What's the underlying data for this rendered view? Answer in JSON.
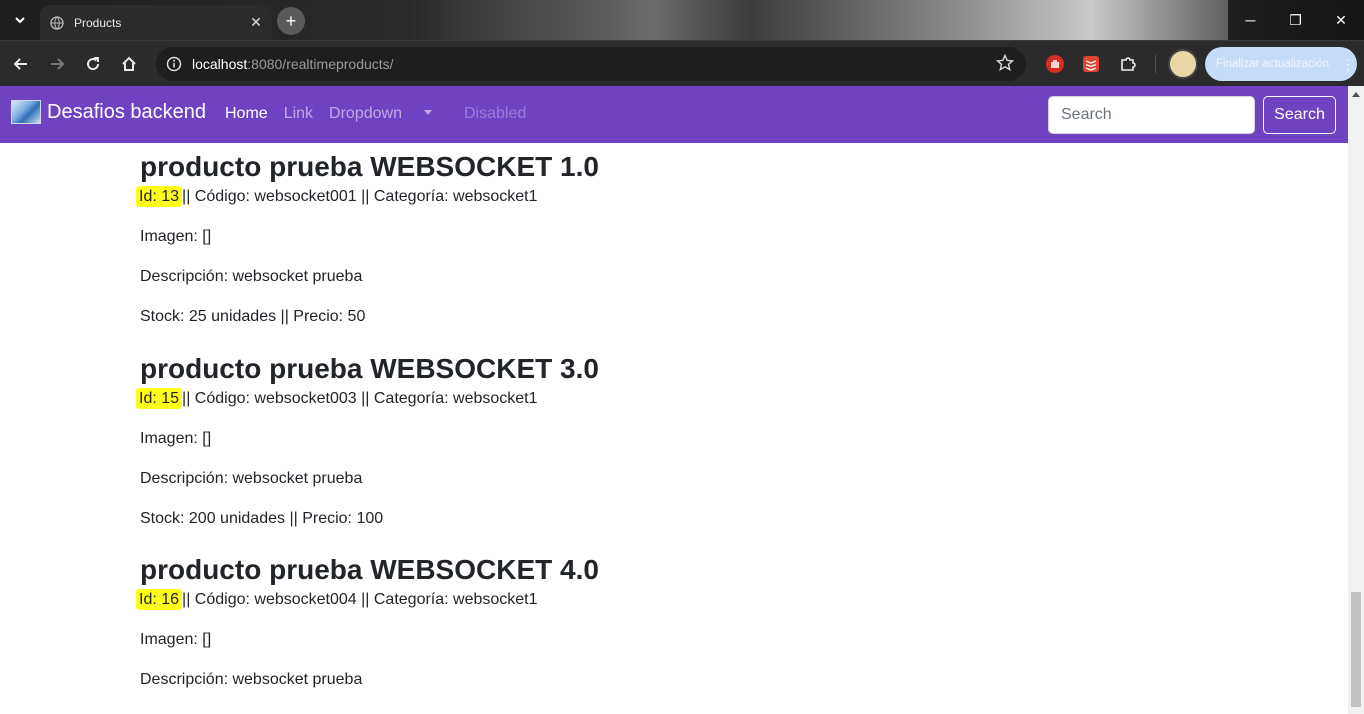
{
  "browser": {
    "tab_title": "Products",
    "url_host": "localhost",
    "url_rest": ":8080/realtimeproducts/",
    "update_label": "Finalizar actualización"
  },
  "navbar": {
    "brand": "Desafios backend",
    "links": [
      "Home",
      "Link",
      "Dropdown",
      "Disabled"
    ],
    "search_placeholder": "Search",
    "search_button": "Search"
  },
  "products": [
    {
      "title": "producto prueba WEBSOCKET 1.0",
      "id_label": "Id: 13",
      "details": "|| Código: websocket001 || Categoría: websocket1",
      "imagen": "Imagen: []",
      "descripcion": "Descripción: websocket prueba",
      "stock": "Stock: 25 unidades || Precio: 50"
    },
    {
      "title": "producto prueba WEBSOCKET 3.0",
      "id_label": "Id: 15",
      "details": "|| Código: websocket003 || Categoría: websocket1",
      "imagen": "Imagen: []",
      "descripcion": "Descripción: websocket prueba",
      "stock": "Stock: 200 unidades || Precio: 100"
    },
    {
      "title": "producto prueba WEBSOCKET 4.0",
      "id_label": "Id: 16",
      "details": "|| Código: websocket004 || Categoría: websocket1",
      "imagen": "Imagen: []",
      "descripcion": "Descripción: websocket prueba",
      "stock": ""
    }
  ],
  "colors": {
    "navbar": "#6f42c1",
    "highlight": "#ffff1a",
    "text": "#212529"
  }
}
